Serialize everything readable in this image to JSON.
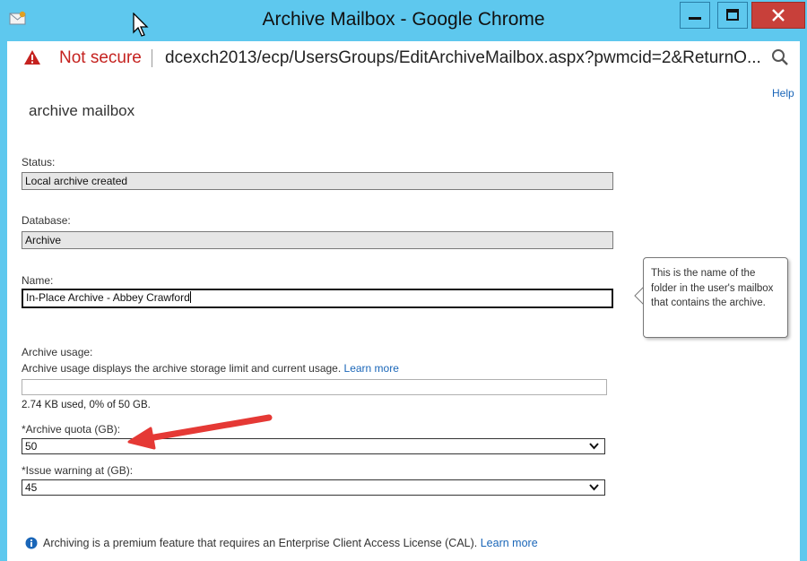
{
  "window": {
    "title": "Archive Mailbox - Google Chrome",
    "minimize_icon": "minimize-icon",
    "maximize_icon": "maximize-icon",
    "close_icon": "close-icon"
  },
  "address_bar": {
    "security_label": "Not secure",
    "url": "dcexch2013/ecp/UsersGroups/EditArchiveMailbox.aspx?pwmcid=2&ReturnO...",
    "warning_icon": "warning-triangle-icon",
    "zoom_icon": "zoom-icon"
  },
  "page": {
    "help_link": "Help",
    "title": "archive mailbox",
    "status_label": "Status:",
    "status_value": "Local archive created",
    "database_label": "Database:",
    "database_value": "Archive",
    "name_label": "Name:",
    "name_value": "In-Place Archive - Abbey Crawford",
    "name_tooltip": "This is the name of the folder in the user's mailbox that contains the archive.",
    "usage_label": "Archive usage:",
    "usage_description": "Archive usage displays the archive storage limit and current usage.",
    "usage_learn_more": "Learn more",
    "usage_percent": 0,
    "usage_summary": "2.74 KB used, 0% of 50 GB.",
    "quota_label": "*Archive quota (GB):",
    "quota_value": "50",
    "warning_label": "*Issue warning at (GB):",
    "warning_value": "45",
    "note_text": "Archiving is a premium feature that requires an Enterprise Client Access License (CAL).",
    "note_learn_more": "Learn more",
    "info_icon": "info-icon"
  },
  "colors": {
    "titlebar": "#5ec8ee",
    "close_button": "#c8403a",
    "link": "#1a66b8",
    "annotation_arrow": "#e53935"
  }
}
